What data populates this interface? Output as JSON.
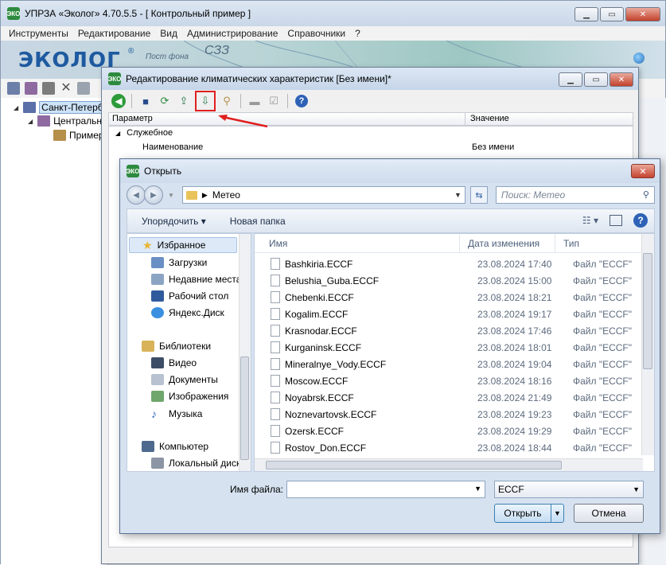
{
  "main_window": {
    "title": "УПРЗА «Эколог» 4.70.5.5 - [ Контрольный пример ]",
    "menu": [
      "Инструменты",
      "Редактирование",
      "Вид",
      "Администрирование",
      "Справочники",
      "?"
    ],
    "banner": {
      "logo": "ЭКОЛОГ",
      "reg": "®",
      "subtitle": "Пост фона",
      "szz": "СЗЗ"
    },
    "tree": [
      {
        "label": "Санкт-Петербу"
      },
      {
        "label": "Центральн"
      },
      {
        "label": "Пример"
      }
    ]
  },
  "climate_window": {
    "title": "Редактирование климатических характеристик [Без имени]*",
    "grid": {
      "col_param": "Параметр",
      "col_value": "Значение",
      "group": "Служебное",
      "row_name": "Наименование",
      "row_value": "Без имени"
    }
  },
  "open_dialog": {
    "title": "Открыть",
    "address": "Метео",
    "search_placeholder": "Поиск: Метео",
    "toolbar": {
      "organize": "Упорядочить",
      "new_folder": "Новая папка"
    },
    "nav": {
      "favorites": "Избранное",
      "downloads": "Загрузки",
      "recent": "Недавние места",
      "desktop": "Рабочий стол",
      "yandex": "Яндекс.Диск",
      "libraries": "Библиотеки",
      "video": "Видео",
      "documents": "Документы",
      "images": "Изображения",
      "music": "Музыка",
      "computer": "Компьютер",
      "local_disk": "Локальный диск"
    },
    "columns": {
      "name": "Имя",
      "date": "Дата изменения",
      "type": "Тип"
    },
    "files": [
      {
        "name": "Bashkiria.ECCF",
        "date": "23.08.2024 17:40",
        "type": "Файл \"ECCF\""
      },
      {
        "name": "Belushia_Guba.ECCF",
        "date": "23.08.2024 15:00",
        "type": "Файл \"ECCF\""
      },
      {
        "name": "Chebenki.ECCF",
        "date": "23.08.2024 18:21",
        "type": "Файл \"ECCF\""
      },
      {
        "name": "Kogalim.ECCF",
        "date": "23.08.2024 19:17",
        "type": "Файл \"ECCF\""
      },
      {
        "name": "Krasnodar.ECCF",
        "date": "23.08.2024 17:46",
        "type": "Файл \"ECCF\""
      },
      {
        "name": "Kurganinsk.ECCF",
        "date": "23.08.2024 18:01",
        "type": "Файл \"ECCF\""
      },
      {
        "name": "Mineralnye_Vody.ECCF",
        "date": "23.08.2024 19:04",
        "type": "Файл \"ECCF\""
      },
      {
        "name": "Moscow.ECCF",
        "date": "23.08.2024 18:16",
        "type": "Файл \"ECCF\""
      },
      {
        "name": "Noyabrsk.ECCF",
        "date": "23.08.2024 21:49",
        "type": "Файл \"ECCF\""
      },
      {
        "name": "Noznevartovsk.ECCF",
        "date": "23.08.2024 19:23",
        "type": "Файл \"ECCF\""
      },
      {
        "name": "Ozersk.ECCF",
        "date": "23.08.2024 19:29",
        "type": "Файл \"ECCF\""
      },
      {
        "name": "Rostov_Don.ECCF",
        "date": "23.08.2024 18:44",
        "type": "Файл \"ECCF\""
      }
    ],
    "filename_label": "Имя файла:",
    "filename_value": "",
    "filetype": "ECCF",
    "open_button": "Открыть",
    "cancel_button": "Отмена"
  },
  "colors": {
    "highlight": "#e02020",
    "title_bg": "#c9d7e8",
    "dialog_bg": "#d6e2f0"
  }
}
